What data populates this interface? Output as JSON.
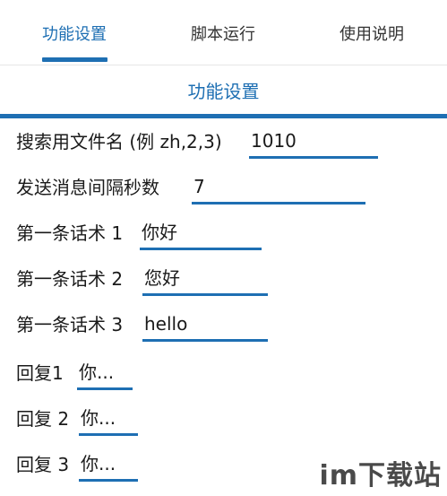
{
  "tabs": [
    {
      "label": "功能设置",
      "active": true
    },
    {
      "label": "脚本运行",
      "active": false
    },
    {
      "label": "使用说明",
      "active": false
    }
  ],
  "section_title": "功能设置",
  "rows": [
    {
      "label": "搜索用文件名 (例 zh,2,3)",
      "value": "1010"
    },
    {
      "label": "发送消息间隔秒数",
      "value": "7"
    },
    {
      "label": "第一条话术 1",
      "value": "你好"
    },
    {
      "label": "第一条话术 2",
      "value": "您好"
    },
    {
      "label": "第一条话术 3",
      "value": "hello"
    },
    {
      "label": "回复1",
      "value": "你..."
    },
    {
      "label": "回复 2",
      "value": "你..."
    },
    {
      "label": "回复 3",
      "value": "你..."
    }
  ],
  "watermark": "im下载站",
  "colors": {
    "accent": "#1e6fb3",
    "text": "#1a1a1a",
    "background": "#ffffff"
  }
}
